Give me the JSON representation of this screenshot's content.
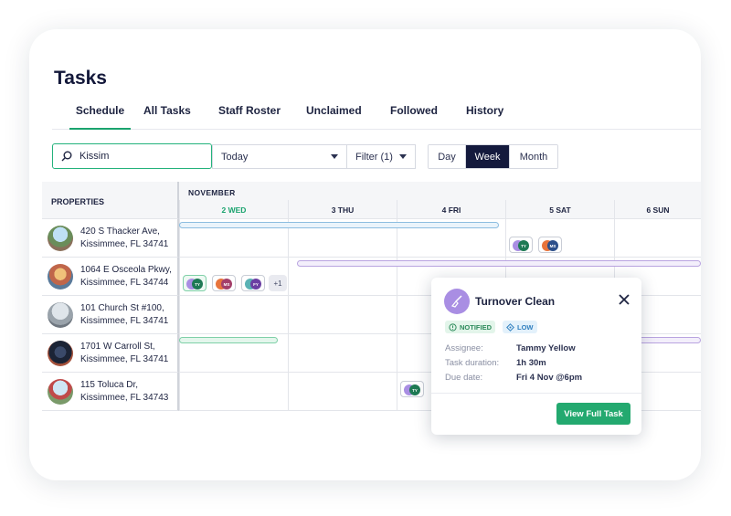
{
  "page": {
    "title": "Tasks"
  },
  "tabs": [
    {
      "label": "Schedule",
      "active": true
    },
    {
      "label": "All Tasks"
    },
    {
      "label": "Staff Roster"
    },
    {
      "label": "Unclaimed"
    },
    {
      "label": "Followed"
    },
    {
      "label": "History"
    }
  ],
  "toolbar": {
    "search_value": "Kissim",
    "date_select": "Today",
    "filter_select": "Filter (1)",
    "views": [
      "Day",
      "Week",
      "Month"
    ],
    "active_view": "Week"
  },
  "schedule": {
    "properties_header": "PROPERTIES",
    "month": "NOVEMBER",
    "days": [
      {
        "label": "2 WED",
        "today": true
      },
      {
        "label": "3 THU"
      },
      {
        "label": "4 FRI"
      },
      {
        "label": "5 SAT"
      },
      {
        "label": "6 SUN"
      }
    ],
    "properties": [
      {
        "line1": "420 S Thacker Ave,",
        "line2": "Kissimmee, FL 34741"
      },
      {
        "line1": "1064 E Osceola Pkwy,",
        "line2": "Kissimmee, FL 34744"
      },
      {
        "line1": "101 Church St #100,",
        "line2": "Kissimmee, FL 34741"
      },
      {
        "line1": "1701 W Carroll St,",
        "line2": "Kissimmee, FL 34741"
      },
      {
        "line1": "115 Toluca Dr,",
        "line2": "Kissimmee, FL 34743"
      }
    ],
    "assignees": {
      "ty": "TY",
      "ms": "MS",
      "fy": "FY"
    },
    "more_count": "+1"
  },
  "popup": {
    "title": "Turnover Clean",
    "badges": {
      "notified": "NOTIFIED",
      "low": "LOW"
    },
    "assignee_label": "Assignee:",
    "assignee_value": "Tammy Yellow",
    "duration_label": "Task duration:",
    "duration_value": "1h 30m",
    "due_label": "Due date:",
    "due_value": "Fri 4 Nov @6pm",
    "button": "View Full Task"
  },
  "colors": {
    "accent": "#23a96f",
    "navy": "#141a3d",
    "task_purple": "#a98ee3"
  },
  "icons": [
    "search-icon",
    "chevron-down-icon",
    "broom-icon",
    "close-icon",
    "info-icon",
    "diamond-icon"
  ]
}
